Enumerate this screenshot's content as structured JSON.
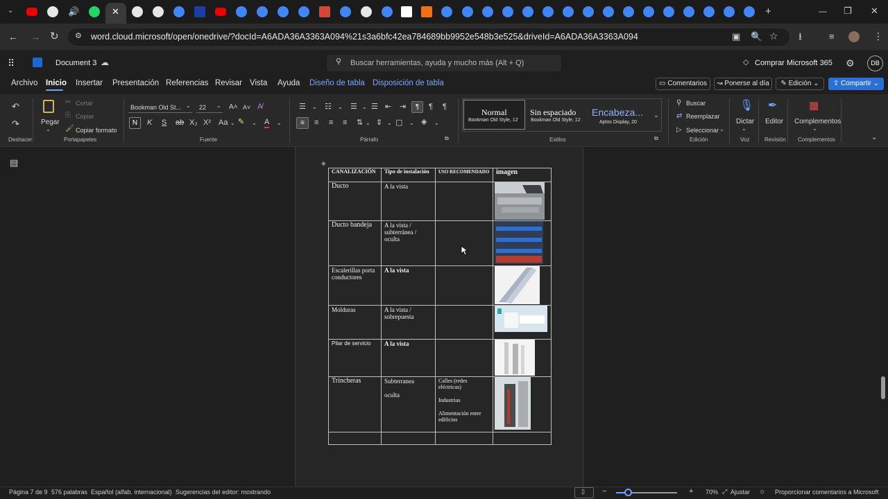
{
  "browser": {
    "url": "word.cloud.microsoft/open/onedrive/?docId=A6ADA36A3363A094%21s3a6bfc42ea784689bb9952e548b3e525&driveId=A6ADA36A3363A094"
  },
  "app": {
    "doc_title": "Document 3",
    "search_placeholder": "Buscar herramientas, ayuda y mucho más (Alt + Q)",
    "buy": "Comprar Microsoft 365",
    "avatar": "DB"
  },
  "ribbon_tabs": [
    "Archivo",
    "Inicio",
    "Insertar",
    "Presentación",
    "Referencias",
    "Revisar",
    "Vista",
    "Ayuda",
    "Diseño de tabla",
    "Disposición de tabla"
  ],
  "actions": {
    "comments": "Comentarios",
    "catchup": "Ponerse al día",
    "editing": "Edición",
    "share": "Compartir"
  },
  "ribbon": {
    "undo_group": "Deshacer",
    "paste": "Pegar",
    "cut": "Cortar",
    "copy": "Copiar",
    "format_painter": "Copiar formato",
    "clipboard": "Portapapeles",
    "font_name": "Bookman Old St...",
    "font_size": "22",
    "font_group": "Fuente",
    "paragraph_group": "Párrafo",
    "styles_group": "Estilos",
    "styles": [
      {
        "name": "Normal",
        "sub": "Bookman Old Style, 12"
      },
      {
        "name": "Sin espaciado",
        "sub": "Bookman Old Style, 12"
      },
      {
        "name": "Encabeza...",
        "sub": "Aptos Display, 20"
      }
    ],
    "find": "Buscar",
    "replace": "Reemplazar",
    "select": "Seleccionar",
    "editing_group": "Edición",
    "dictate": "Dictar",
    "voice_group": "Voz",
    "editor": "Editor",
    "review_group": "Revisión",
    "addins": "Complementos",
    "addins_group": "Complementos"
  },
  "table": {
    "headers": [
      "CANALIZACIÓN",
      "Tipo de instalación",
      "USO RECOMENDADO",
      "imagen"
    ],
    "rows": [
      {
        "c1": "Ducto",
        "c2": "A la vista",
        "c3": ""
      },
      {
        "c1": "Ducto bandeja",
        "c2": "A la vista / subterránea / oculta",
        "c3": ""
      },
      {
        "c1": " Escalerillas porta conductores",
        "c2": "A la vista",
        "c3": ""
      },
      {
        "c1": "Molduras",
        "c2": "A la vista / sobrepuesta",
        "c3": ""
      },
      {
        "c1": "Pilar de servicio",
        "c2": "A la vista",
        "c3": ""
      },
      {
        "c1": "Trincheras",
        "c2": "Subterranea",
        "c2b": "oculta",
        "c3a": "Calles (redes eléctricas)",
        "c3b": "Industrias",
        "c3c": "Alimentación entre edificios"
      }
    ]
  },
  "status": {
    "page": "Página 7 de 9",
    "words": "576 palabras",
    "lang": "Español (alfab. internacional)",
    "suggestions": "Sugerencias del editor: mostrando",
    "zoom": "70%",
    "fit": "Ajustar",
    "feedback": "Proporcionar comentarios a Microsoft"
  }
}
